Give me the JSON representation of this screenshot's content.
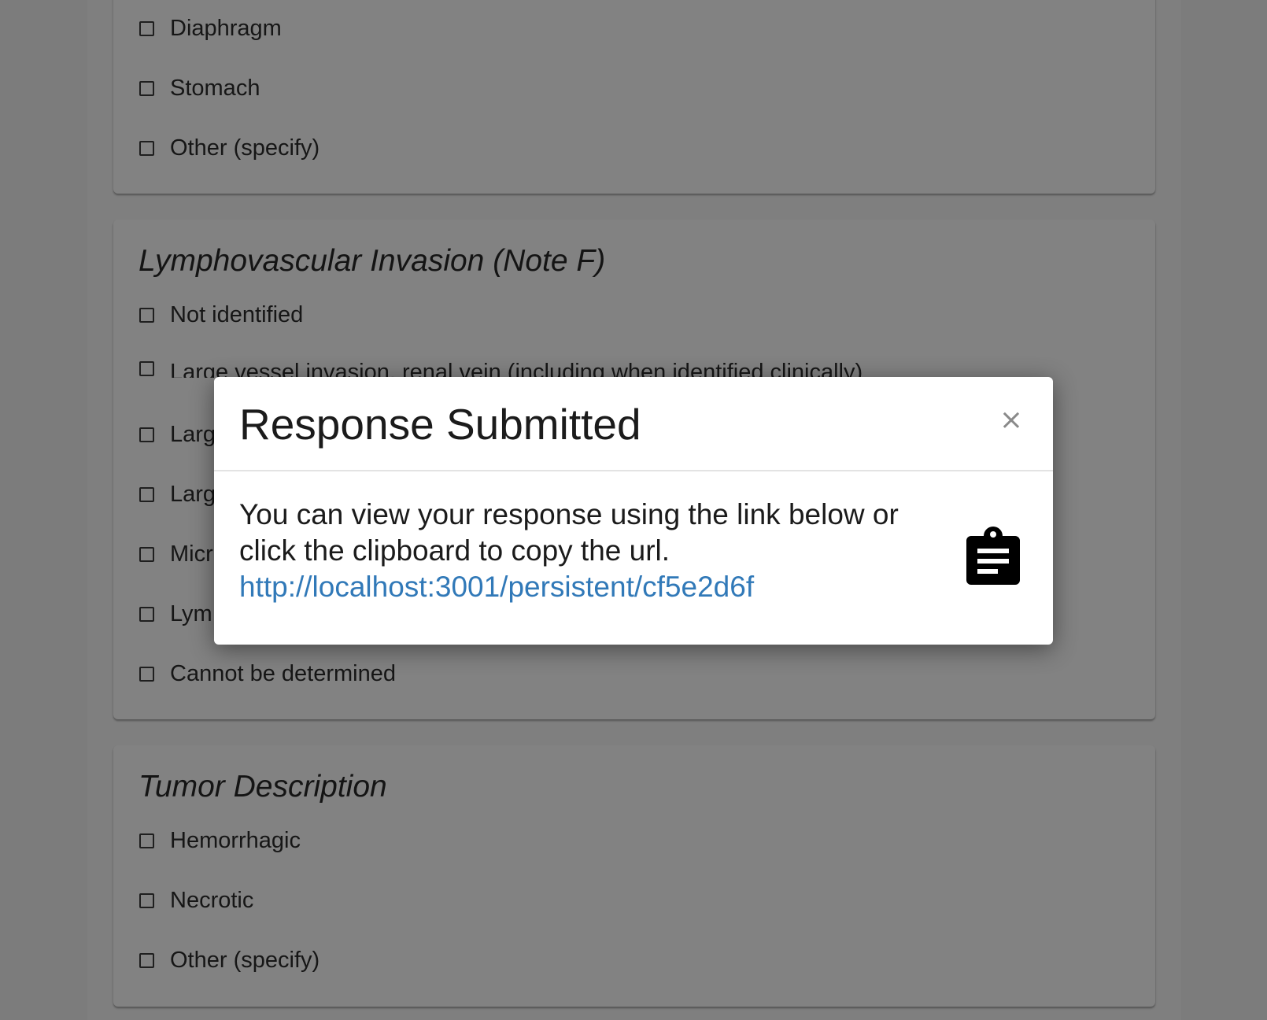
{
  "sections": [
    {
      "title": "",
      "options": [
        "Diaphragm",
        "Stomach",
        "Other (specify)"
      ]
    },
    {
      "title": "Lymphovascular Invasion (Note F)",
      "options": [
        "Not identified",
        "Large vessel invasion, renal vein (including when identified clinically)",
        "Larg",
        "Larg",
        "Micr",
        "Lym",
        "Cannot be determined"
      ]
    },
    {
      "title": "Tumor Description",
      "options": [
        "Hemorrhagic",
        "Necrotic",
        "Other (specify)"
      ]
    }
  ],
  "modal": {
    "title": "Response Submitted",
    "close_label": "×",
    "message": "You can view your response using the link below or click the clipboard to copy the url.",
    "link": "http://localhost:3001/persistent/cf5e2d6f",
    "icons": {
      "close": "close-icon",
      "clipboard": "clipboard-icon"
    }
  },
  "colors": {
    "overlay_dim": "#7f7f7f",
    "modal_bg": "#ffffff",
    "link": "#3179b8"
  }
}
